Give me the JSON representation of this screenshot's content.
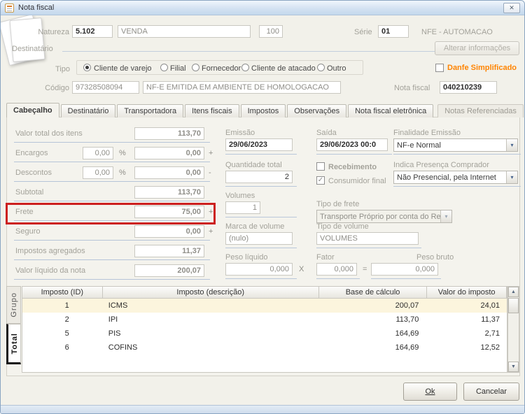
{
  "window": {
    "title": "Nota fiscal"
  },
  "icons": {
    "close": "✕",
    "dropdown": "▾",
    "scroll_up": "▲",
    "scroll_down": "▼"
  },
  "colors": {
    "danfe_text": "#ff8400",
    "annotation_box": "#cc1f1f",
    "highlight_row": "#fcf5dd",
    "titlebar": "#d4e2f2"
  },
  "header": {
    "natureza": {
      "label": "Natureza",
      "code": "5.102",
      "desc": "VENDA",
      "num": "100"
    },
    "serie": {
      "label": "Série",
      "value": "01",
      "desc": "NFE - AUTOMACAO"
    },
    "destinatario_label": "Destinatário",
    "alterar_button": "Alterar informações",
    "tipo": {
      "label": "Tipo",
      "options": [
        "Cliente de varejo",
        "Filial",
        "Fornecedor",
        "Cliente de atacado",
        "Outro"
      ],
      "selected": "Cliente de varejo"
    },
    "danfe": {
      "label": "Danfe Simplificado",
      "checked": false,
      "mark": ""
    },
    "codigo": {
      "label": "Código",
      "value": "97328508094",
      "desc": "NF-E EMITIDA EM AMBIENTE DE HOMOLOGACAO"
    },
    "nota_fiscal": {
      "label": "Nota fiscal",
      "value": "040210239"
    }
  },
  "tabs": {
    "items": [
      "Cabeçalho",
      "Destinatário",
      "Transportadora",
      "Itens fiscais",
      "Impostos",
      "Observações",
      "Nota fiscal eletrônica",
      "Notas Referenciadas"
    ],
    "active": "Cabeçalho",
    "disabled": "Notas Referenciadas"
  },
  "cabecalho": {
    "valor_total": {
      "label": "Valor total dos itens",
      "value": "113,70"
    },
    "encargos": {
      "label": "Encargos",
      "pct": "0,00",
      "pct_sign": "%",
      "value": "0,00",
      "op": "+"
    },
    "descontos": {
      "label": "Descontos",
      "pct": "0,00",
      "pct_sign": "%",
      "value": "0,00",
      "op": "-"
    },
    "subtotal": {
      "label": "Subtotal",
      "value": "113,70"
    },
    "frete": {
      "label": "Frete",
      "value": "75,00",
      "op": "+"
    },
    "seguro": {
      "label": "Seguro",
      "value": "0,00",
      "op": "+"
    },
    "impostos_agregados": {
      "label": "Impostos agregados",
      "value": "11,37"
    },
    "valor_liquido": {
      "label": "Valor líquido da nota",
      "value": "200,07"
    },
    "emissao": {
      "label": "Emissão",
      "value": "29/06/2023"
    },
    "saida": {
      "label": "Saída",
      "value": "29/06/2023 00:0"
    },
    "finalidade": {
      "label": "Finalidade Emissão",
      "value": "NF-e Normal"
    },
    "quantidade_total": {
      "label": "Quantidade total",
      "value": "2"
    },
    "recebimento": {
      "label": "Recebimento",
      "checked": false,
      "mark": ""
    },
    "consumidor_final": {
      "label": "Consumidor final",
      "checked": true,
      "mark": "✓"
    },
    "indica_presenca": {
      "label": "Indica Presença Comprador",
      "value": "Não Presencial, pela Internet"
    },
    "volumes": {
      "label": "Volumes",
      "value": "1"
    },
    "tipo_frete": {
      "label": "Tipo de frete",
      "value": "Transporte Próprio por conta do Remete"
    },
    "marca_volume": {
      "label": "Marca de volume",
      "value": "(nulo)"
    },
    "tipo_volume": {
      "label": "Tipo de volume",
      "value": "VOLUMES"
    },
    "peso_liquido": {
      "label": "Peso líquido",
      "value": "0,000"
    },
    "fator": {
      "label": "Fator",
      "value": "0,000",
      "times": "X",
      "equals": "="
    },
    "peso_bruto": {
      "label": "Peso bruto",
      "value": "0,000"
    }
  },
  "impostos_table": {
    "group_tabs": [
      "Grupo",
      "Total"
    ],
    "active_group_tab": "Total",
    "columns": [
      "Imposto (ID)",
      "Imposto (descrição)",
      "Base de cálculo",
      "Valor do imposto"
    ],
    "rows": [
      {
        "id": "1",
        "desc": "ICMS",
        "base": "200,07",
        "valor": "24,01"
      },
      {
        "id": "2",
        "desc": "IPI",
        "base": "113,70",
        "valor": "11,37"
      },
      {
        "id": "5",
        "desc": "PIS",
        "base": "164,69",
        "valor": "2,71"
      },
      {
        "id": "6",
        "desc": "COFINS",
        "base": "164,69",
        "valor": "12,52"
      }
    ]
  },
  "footer": {
    "ok": "Ok",
    "cancel": "Cancelar"
  }
}
